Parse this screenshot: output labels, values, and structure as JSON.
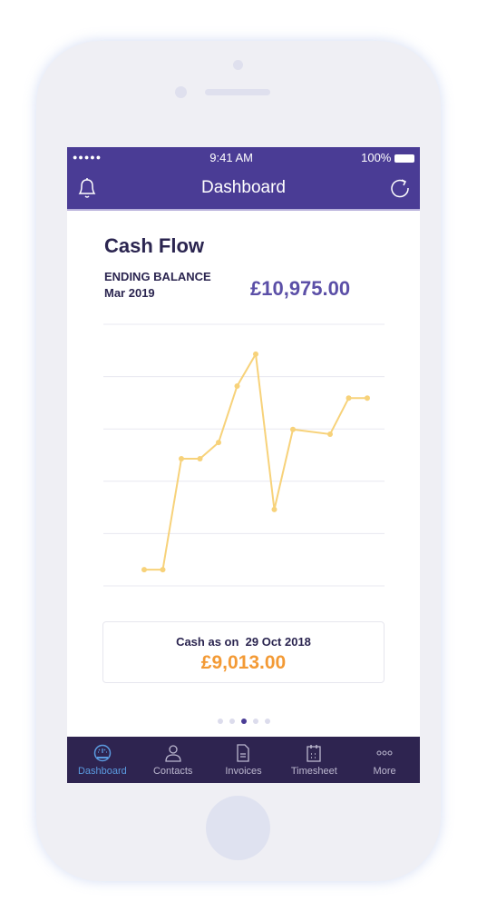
{
  "status": {
    "signal": "●●●●●",
    "time": "9:41 AM",
    "battery": "100%"
  },
  "nav": {
    "title": "Dashboard",
    "left_icon": "bell-icon",
    "right_icon": "refresh-icon"
  },
  "card": {
    "title": "Cash Flow",
    "ending_label": "ENDING BALANCE",
    "period": "Mar 2019",
    "balance": "£10,975.00"
  },
  "chart_data": {
    "type": "line",
    "title": "",
    "xlabel": "",
    "ylabel": "",
    "grid": true,
    "color": "#f7d27a",
    "ylim": [
      0,
      5
    ],
    "x": [
      0,
      1,
      2,
      3,
      4,
      5,
      6,
      7,
      8,
      10,
      11,
      12
    ],
    "values": [
      0.31,
      0.31,
      2.43,
      2.43,
      2.74,
      3.82,
      4.43,
      1.46,
      2.99,
      2.9,
      3.59,
      3.59
    ]
  },
  "cash": {
    "label": "Cash as on  29 Oct 2018",
    "value": "£9,013.00"
  },
  "pager": {
    "count": 5,
    "active": 3
  },
  "tabs": [
    {
      "label": "Dashboard",
      "active": true
    },
    {
      "label": "Contacts"
    },
    {
      "label": "Invoices"
    },
    {
      "label": "Timesheet"
    },
    {
      "label": "More"
    }
  ]
}
